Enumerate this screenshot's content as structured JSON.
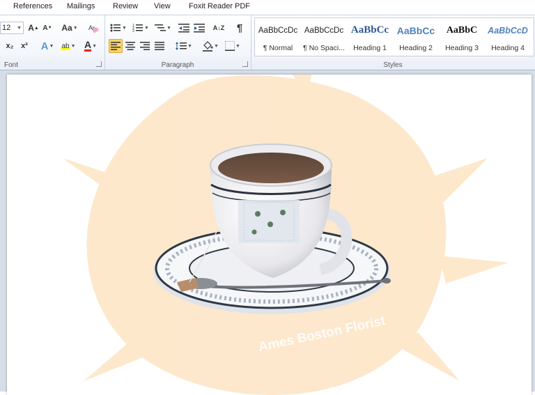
{
  "tabs": [
    "References",
    "Mailings",
    "Review",
    "View",
    "Foxit Reader PDF"
  ],
  "font_group": {
    "label": "Font",
    "font_size": "12",
    "grow_label": "A",
    "shrink_label": "A",
    "change_case_label": "Aa",
    "subscript_label": "x₂",
    "superscript_label": "x²",
    "text_effects_label": "A",
    "highlight_label": "ab",
    "font_color_label": "A"
  },
  "paragraph_group": {
    "label": "Paragraph",
    "pilcrow": "¶",
    "sort_label": "A↓Z"
  },
  "styles_group": {
    "label": "Styles",
    "items": [
      {
        "preview": "AaBbCcDc",
        "name": "¶ Normal"
      },
      {
        "preview": "AaBbCcDc",
        "name": "¶ No Spaci..."
      },
      {
        "preview": "AaBbCc",
        "name": "Heading 1"
      },
      {
        "preview": "AaBbCc",
        "name": "Heading 2"
      },
      {
        "preview": "AaBbC",
        "name": "Heading 3"
      },
      {
        "preview": "AaBbCcD",
        "name": "Heading 4"
      }
    ]
  },
  "document": {
    "watermark_text": "Ames Boston Florist",
    "image_description_icon": "teacup-saucer-image"
  },
  "colors": {
    "accent_highlight": "#fbd46b",
    "heading_blue": "#2b5797",
    "heading_blue_light": "#4f81bd",
    "watermark_peach": "#fde4c4"
  }
}
